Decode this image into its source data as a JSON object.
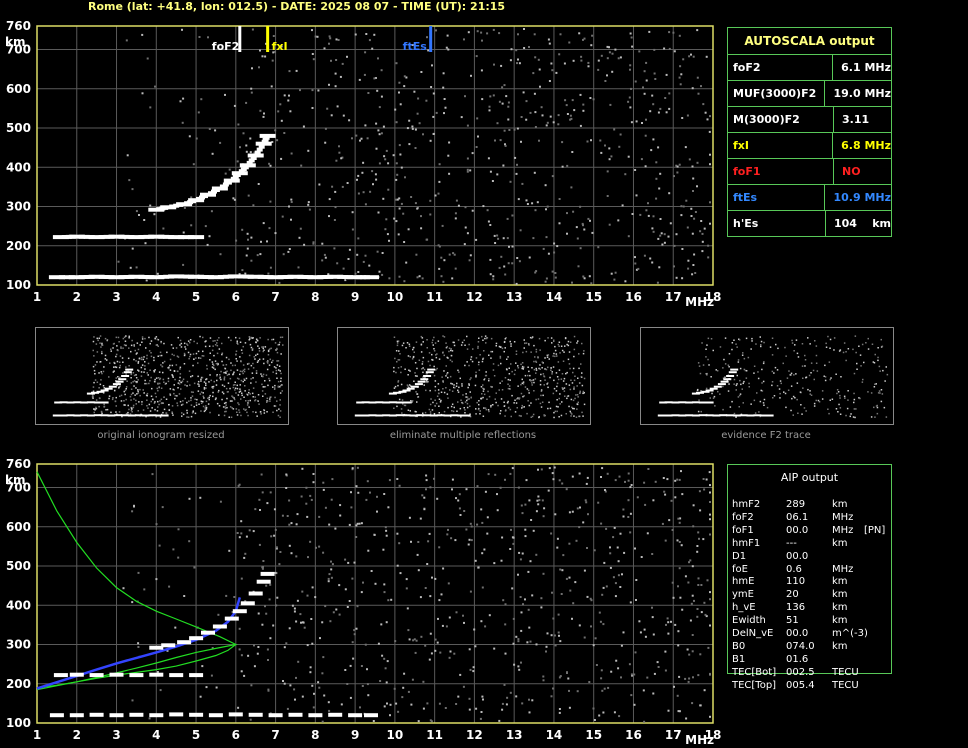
{
  "header": {
    "title": "Rome (lat: +41.8, lon: 012.5) - DATE: 2025 08 07 - TIME (UT): 21:15"
  },
  "chart_data": [
    {
      "type": "scatter",
      "title": "",
      "xlabel": "MHz",
      "ylabel": "km",
      "xlim": [
        1,
        18
      ],
      "ylim": [
        100,
        760
      ],
      "x_ticks": [
        "1",
        "2",
        "3",
        "4",
        "5",
        "6",
        "7",
        "8",
        "9",
        "10",
        "11",
        "12",
        "13",
        "14",
        "15",
        "16",
        "17",
        "18"
      ],
      "y_ticks": [
        "100",
        "200",
        "300",
        "400",
        "500",
        "600",
        "700",
        "760"
      ],
      "grid": true,
      "series": [
        {
          "name": "",
          "color": "#ffffff",
          "x": [
            1.5,
            2,
            2.5,
            3,
            3.5,
            4,
            4.5,
            5,
            5.5,
            6,
            6.5,
            7,
            7.5,
            8,
            8.5,
            9,
            9.4
          ],
          "y": [
            120,
            120,
            121,
            120,
            121,
            120,
            122,
            121,
            120,
            122,
            121,
            120,
            121,
            120,
            121,
            120,
            120
          ]
        },
        {
          "name": "",
          "color": "#ffffff",
          "x": [
            1.6,
            2,
            2.5,
            3,
            3.5,
            4,
            4.5,
            5
          ],
          "y": [
            222,
            223,
            222,
            223,
            222,
            223,
            222,
            222
          ]
        },
        {
          "name": "",
          "color": "#ffffff",
          "x": [
            4.0,
            4.3,
            4.7,
            5.0,
            5.3,
            5.6,
            5.9,
            6.1,
            6.3,
            6.5,
            6.7,
            6.8
          ],
          "y": [
            292,
            298,
            306,
            316,
            330,
            346,
            366,
            385,
            405,
            430,
            460,
            480
          ]
        }
      ],
      "markers": [
        {
          "label": "foF2",
          "x": 6.1,
          "color": "#ffffff"
        },
        {
          "label": "fxI",
          "x": 6.8,
          "color": "#ffff00"
        },
        {
          "label": "ftEs",
          "x": 10.9,
          "color": "#3377ff"
        }
      ]
    },
    {
      "type": "line",
      "title": "",
      "xlabel": "MHz",
      "ylabel": "km",
      "xlim": [
        1,
        18
      ],
      "ylim": [
        100,
        760
      ],
      "x_ticks": [
        "1",
        "2",
        "3",
        "4",
        "5",
        "6",
        "7",
        "8",
        "9",
        "10",
        "11",
        "12",
        "13",
        "14",
        "15",
        "16",
        "17",
        "18"
      ],
      "y_ticks": [
        "100",
        "200",
        "300",
        "400",
        "500",
        "600",
        "700",
        "760"
      ],
      "grid": true,
      "series": [
        {
          "name": "",
          "color": "#22dd22",
          "x": [
            1.0,
            1.5,
            2.0,
            2.5,
            3.0,
            3.5,
            4.0,
            4.5,
            5.0,
            5.5,
            6.0,
            5.6,
            5.0,
            4.5,
            4.0,
            3.5,
            3.0,
            2.5,
            2.0,
            1.5,
            1.0
          ],
          "y": [
            190,
            196,
            205,
            216,
            228,
            240,
            253,
            267,
            280,
            290,
            300,
            320,
            345,
            365,
            385,
            410,
            445,
            495,
            560,
            640,
            740
          ]
        },
        {
          "name": "",
          "color": "#22dd22",
          "x": [
            1.0,
            1.5,
            2.0,
            2.5,
            3.0,
            3.5,
            4.0,
            4.5,
            5.0,
            5.5,
            5.8,
            6.0
          ],
          "y": [
            185,
            195,
            205,
            214,
            222,
            229,
            236,
            245,
            258,
            272,
            285,
            300
          ]
        },
        {
          "name": "",
          "color": "#3344ff",
          "x": [
            1.0,
            1.5,
            2.0,
            2.5,
            3.0,
            3.5,
            4.0,
            4.5,
            5.0,
            5.5,
            5.8,
            6.0,
            6.1
          ],
          "y": [
            188,
            204,
            220,
            236,
            252,
            266,
            280,
            295,
            312,
            335,
            358,
            385,
            420
          ]
        }
      ]
    }
  ],
  "autoscala": {
    "title": "AUTOSCALA output",
    "rows": [
      {
        "label": "foF2",
        "value": "6.1 MHz",
        "color": "#ffffff"
      },
      {
        "label": "MUF(3000)F2",
        "value": "19.0 MHz",
        "color": "#ffffff"
      },
      {
        "label": "M(3000)F2",
        "value": "3.11",
        "color": "#ffffff"
      },
      {
        "label": "fxI",
        "value": "6.8 MHz",
        "color": "#ffff00"
      },
      {
        "label": "foF1",
        "value": "NO",
        "color": "#ff2020"
      },
      {
        "label": "ftEs",
        "value": "10.9 MHz",
        "color": "#3388ff"
      },
      {
        "label": "h'Es",
        "value": "104    km",
        "color": "#ffffff"
      }
    ]
  },
  "thumbnails": [
    {
      "caption": "original ionogram resized"
    },
    {
      "caption": "eliminate multiple reflections"
    },
    {
      "caption": "evidence F2 trace"
    }
  ],
  "aip": {
    "title": "AIP output",
    "rows": [
      {
        "name": "hmF2",
        "value": "289",
        "unit": "km",
        "extra": ""
      },
      {
        "name": "foF2",
        "value": "06.1",
        "unit": "MHz",
        "extra": ""
      },
      {
        "name": "foF1",
        "value": "00.0",
        "unit": "MHz",
        "extra": "[PN]"
      },
      {
        "name": "hmF1",
        "value": "---",
        "unit": "km",
        "extra": ""
      },
      {
        "name": "D1",
        "value": "00.0",
        "unit": "",
        "extra": ""
      },
      {
        "name": "foE",
        "value": "0.6",
        "unit": "MHz",
        "extra": ""
      },
      {
        "name": "hmE",
        "value": "110",
        "unit": "km",
        "extra": ""
      },
      {
        "name": "ymE",
        "value": "20",
        "unit": "km",
        "extra": ""
      },
      {
        "name": "h_vE",
        "value": "136",
        "unit": "km",
        "extra": ""
      },
      {
        "name": "Ewidth",
        "value": "51",
        "unit": "km",
        "extra": ""
      },
      {
        "name": "DelN_vE",
        "value": "00.0",
        "unit": "m^(-3)",
        "extra": ""
      },
      {
        "name": "B0",
        "value": "074.0",
        "unit": "km",
        "extra": ""
      },
      {
        "name": "B1",
        "value": "01.6",
        "unit": "",
        "extra": ""
      },
      {
        "name": "TEC[Bot]",
        "value": "002.5",
        "unit": "TECU",
        "extra": ""
      },
      {
        "name": "TEC[Top]",
        "value": "005.4",
        "unit": "TECU",
        "extra": ""
      }
    ]
  }
}
